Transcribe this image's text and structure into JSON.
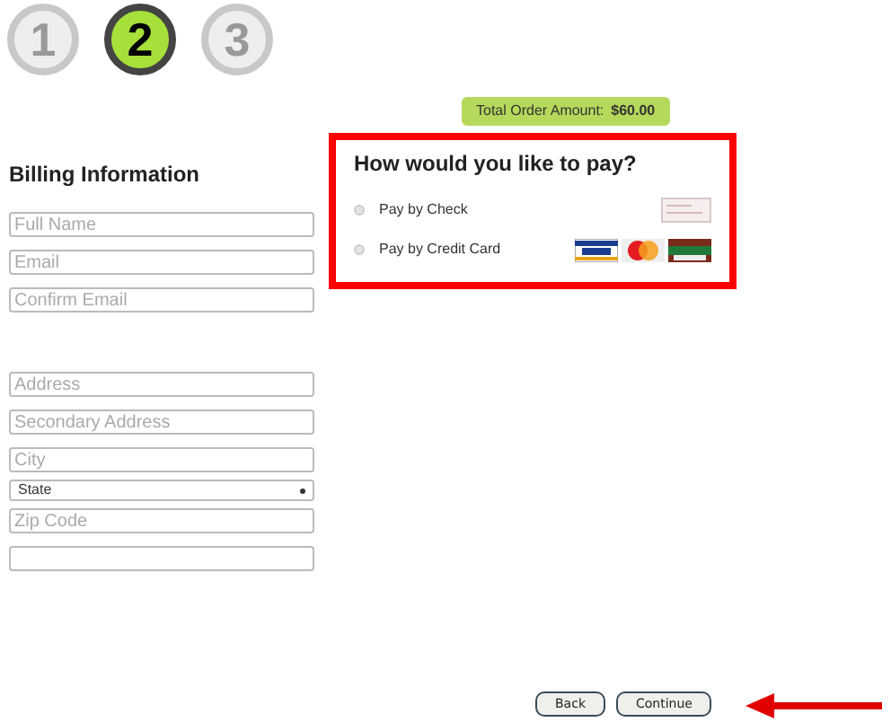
{
  "steps": [
    {
      "label": "1",
      "selected": false
    },
    {
      "label": "2",
      "selected": true
    },
    {
      "label": "3",
      "selected": false
    }
  ],
  "total": {
    "label": "Total Order Amount:",
    "amount": "$60.00"
  },
  "billing": {
    "title": "Billing Information",
    "fields": [
      {
        "kind": "input",
        "placeholder": "Full Name"
      },
      {
        "kind": "input",
        "placeholder": "Email"
      },
      {
        "kind": "input",
        "placeholder": "Confirm Email"
      },
      {
        "kind": "gap"
      },
      {
        "kind": "input",
        "placeholder": "Address"
      },
      {
        "kind": "input",
        "placeholder": "Secondary Address"
      },
      {
        "kind": "input",
        "placeholder": "City"
      },
      {
        "kind": "select",
        "value": "State"
      },
      {
        "kind": "input",
        "placeholder": "Zip Code"
      },
      {
        "kind": "input"
      }
    ]
  },
  "payment": {
    "title": "How would you like to pay?",
    "options": [
      {
        "label": "Pay by Check",
        "selected": false,
        "kind": "check"
      },
      {
        "label": "Pay by Credit Card",
        "selected": false,
        "kind": "card"
      }
    ]
  },
  "buttons": [
    "Back",
    "Continue"
  ]
}
